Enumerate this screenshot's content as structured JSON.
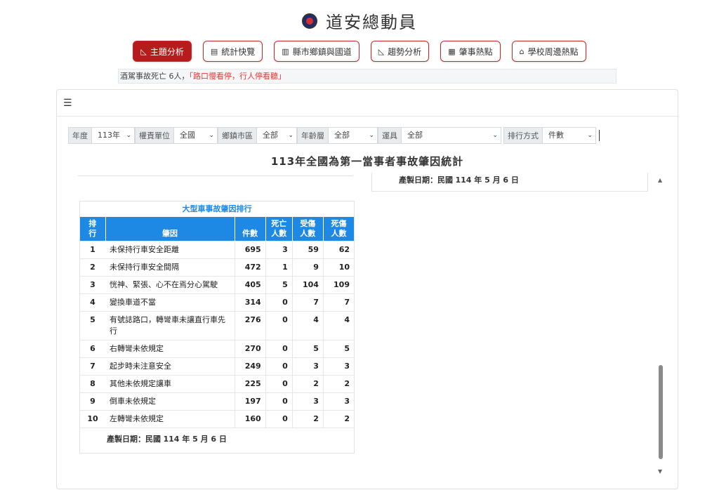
{
  "header": {
    "title": "道安總動員",
    "logo_icon": "police-emblem-icon"
  },
  "nav": [
    {
      "label": "主題分析",
      "icon": "chart-area-icon",
      "glyph": "◺",
      "active": true
    },
    {
      "label": "統計快覽",
      "icon": "dashboard-icon",
      "glyph": "▤",
      "active": false
    },
    {
      "label": "縣市鄉鎮與國道",
      "icon": "bar-chart-icon",
      "glyph": "▥",
      "active": false
    },
    {
      "label": "趨勢分析",
      "icon": "line-chart-icon",
      "glyph": "◺",
      "active": false
    },
    {
      "label": "肇事熱點",
      "icon": "map-icon",
      "glyph": "▦",
      "active": false
    },
    {
      "label": "學校周邊熱點",
      "icon": "school-icon",
      "glyph": "⌂",
      "active": false
    }
  ],
  "marquee": {
    "text": "酒駕事故死亡 6人，",
    "highlight": "「路口慢看停，行人停看聽」"
  },
  "filters": {
    "year": {
      "label": "年度",
      "value": "113年"
    },
    "unit": {
      "label": "權責單位",
      "value": "全國"
    },
    "district": {
      "label": "鄉鎮市區",
      "value": "全部"
    },
    "age": {
      "label": "年齡層",
      "value": "全部"
    },
    "vehicle": {
      "label": "運具",
      "value": "全部"
    },
    "sort": {
      "label": "排行方式",
      "value": "件數"
    }
  },
  "report": {
    "title": "113年全國為第一當事者事故肇因統計",
    "right_date_label": "產製日期：民國",
    "right_date_value": "114 年 5 月 6 日"
  },
  "table": {
    "caption": "大型車事故肇因排行",
    "headers": {
      "rank_1": "排",
      "rank_2": "行",
      "cause": "肇因",
      "count": "件數",
      "deaths_1": "死亡",
      "deaths_2": "人數",
      "injured_1": "受傷",
      "injured_2": "人數",
      "casualties_1": "死傷",
      "casualties_2": "人數"
    },
    "rows": [
      {
        "rank": "1",
        "cause": "未保持行車安全距離",
        "count": "695",
        "deaths": "3",
        "injured": "59",
        "casualties": "62"
      },
      {
        "rank": "2",
        "cause": "未保持行車安全間隔",
        "count": "472",
        "deaths": "1",
        "injured": "9",
        "casualties": "10"
      },
      {
        "rank": "3",
        "cause": "恍神、緊張、心不在焉分心駕駛",
        "count": "405",
        "deaths": "5",
        "injured": "104",
        "casualties": "109"
      },
      {
        "rank": "4",
        "cause": "變換車道不當",
        "count": "314",
        "deaths": "0",
        "injured": "7",
        "casualties": "7"
      },
      {
        "rank": "5",
        "cause": "有號誌路口，轉彎車未讓直行車先行",
        "count": "276",
        "deaths": "0",
        "injured": "4",
        "casualties": "4"
      },
      {
        "rank": "6",
        "cause": "右轉彎未依規定",
        "count": "270",
        "deaths": "0",
        "injured": "5",
        "casualties": "5"
      },
      {
        "rank": "7",
        "cause": "起步時未注意安全",
        "count": "249",
        "deaths": "0",
        "injured": "3",
        "casualties": "3"
      },
      {
        "rank": "8",
        "cause": "其他未依規定讓車",
        "count": "225",
        "deaths": "0",
        "injured": "2",
        "casualties": "2"
      },
      {
        "rank": "9",
        "cause": "倒車未依規定",
        "count": "197",
        "deaths": "0",
        "injured": "3",
        "casualties": "3"
      },
      {
        "rank": "10",
        "cause": "左轉彎未依規定",
        "count": "160",
        "deaths": "0",
        "injured": "2",
        "casualties": "2"
      }
    ],
    "footer_label": "產製日期：民國",
    "footer_value": "114 年 5 月 6 日"
  }
}
